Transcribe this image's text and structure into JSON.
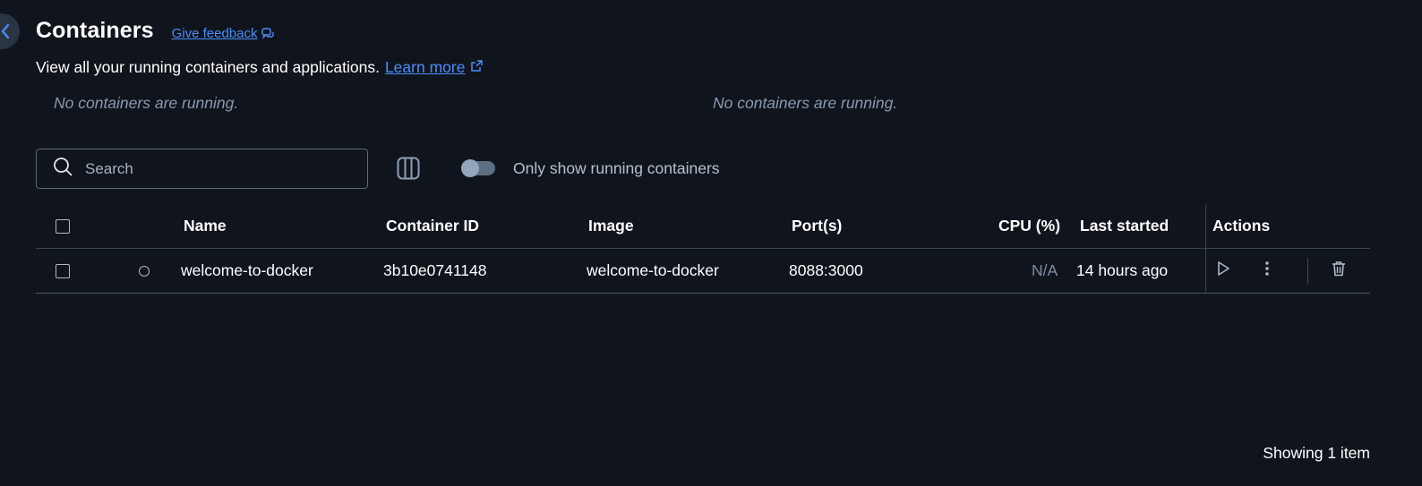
{
  "header": {
    "title": "Containers",
    "feedback_label": "Give feedback",
    "subtitle": "View all your running containers and applications.",
    "learn_more_label": "Learn more"
  },
  "summary": {
    "left_message": "No containers are running.",
    "right_message": "No containers are running."
  },
  "toolbar": {
    "search_placeholder": "Search",
    "toggle_label": "Only show running containers",
    "toggle_on": false
  },
  "table": {
    "columns": {
      "name": "Name",
      "container_id": "Container ID",
      "image": "Image",
      "ports": "Port(s)",
      "cpu": "CPU (%)",
      "last_started": "Last started",
      "actions": "Actions"
    },
    "rows": [
      {
        "name": "welcome-to-docker",
        "container_id": "3b10e0741148",
        "image": "welcome-to-docker",
        "ports": "8088:3000",
        "cpu": "N/A",
        "last_started": "14 hours ago",
        "status": "stopped"
      }
    ]
  },
  "footer": {
    "count_label": "Showing 1 item"
  },
  "colors": {
    "background": "#10151d",
    "accent_link": "#4a8dfa",
    "muted_text": "#8a99ae",
    "border": "#5b6676"
  },
  "icons": {
    "back": "chevron-left-icon",
    "feedback": "chat-bubbles-icon",
    "external": "external-link-icon",
    "search": "search-icon",
    "columns": "columns-icon",
    "start": "play-icon",
    "more": "kebab-menu-icon",
    "delete": "trash-icon"
  }
}
